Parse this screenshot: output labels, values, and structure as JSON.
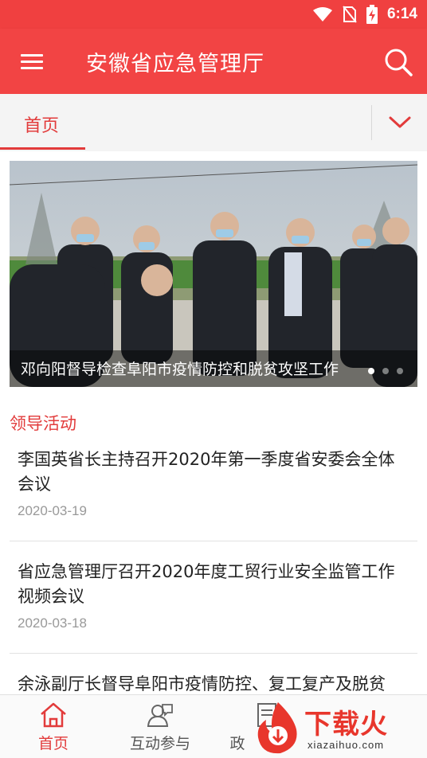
{
  "status_bar": {
    "time": "6:14",
    "icons": [
      "wifi-icon",
      "no-sim-icon",
      "battery-charging-icon"
    ]
  },
  "app_bar": {
    "title": "安徽省应急管理厅",
    "icons": [
      "menu-icon",
      "search-icon"
    ]
  },
  "tabs": {
    "items": [
      {
        "label": "首页",
        "active": true
      }
    ],
    "expand_icon": "chevron-down-icon"
  },
  "banner": {
    "caption": "邓向阳督导检查阜阳市疫情防控和脱贫攻坚工作",
    "slide_count": 3,
    "active_slide": 1
  },
  "section": {
    "title": "领导活动"
  },
  "news": [
    {
      "title": "李国英省长主持召开2020年第一季度省安委会全体会议",
      "date": "2020-03-19"
    },
    {
      "title": "省应急管理厅召开2020年度工贸行业安全监管工作视频会议",
      "date": "2020-03-18"
    },
    {
      "title": "余泳副厅长督导阜阳市疫情防控、复工复产及脱贫",
      "date": ""
    }
  ],
  "bottom_nav": [
    {
      "label": "首页",
      "icon": "home-icon",
      "active": true
    },
    {
      "label": "互动参与",
      "icon": "people-icon",
      "active": false
    },
    {
      "label": "政",
      "icon": "document-icon",
      "active": false
    }
  ],
  "watermark": {
    "text": "下载火",
    "url": "xiazaihuo.com"
  },
  "colors": {
    "primary": "#f24444",
    "accent_text": "#e23b3b",
    "date_text": "#999999"
  }
}
